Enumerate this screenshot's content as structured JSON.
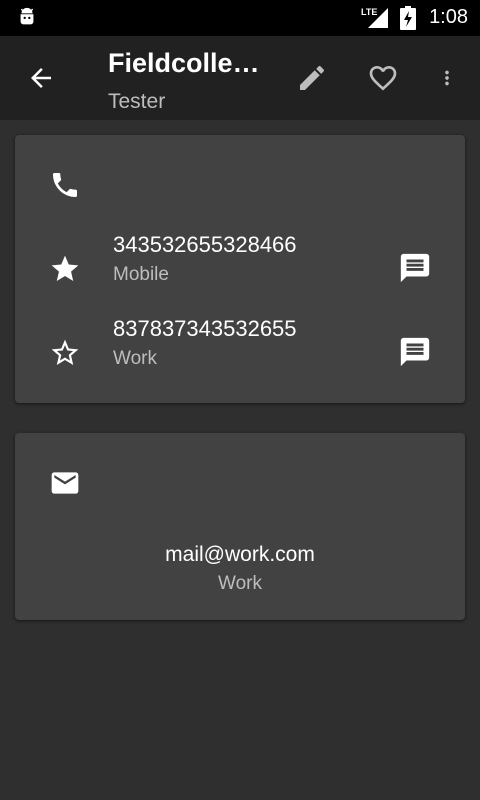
{
  "statusbar": {
    "network": "LTE",
    "time": "1:08"
  },
  "appbar": {
    "title": "Fieldcolle…",
    "subtitle": "Tester"
  },
  "phones": [
    {
      "number": "343532655328466",
      "label": "Mobile",
      "starred": true
    },
    {
      "number": "837837343532655",
      "label": "Work",
      "starred": false
    }
  ],
  "emails": [
    {
      "address": "mail@work.com",
      "label": "Work"
    }
  ],
  "colors": {
    "background": "#2f2f2f",
    "appbar": "#212121",
    "card": "#424242",
    "secondary_text": "#bdbdbd"
  }
}
